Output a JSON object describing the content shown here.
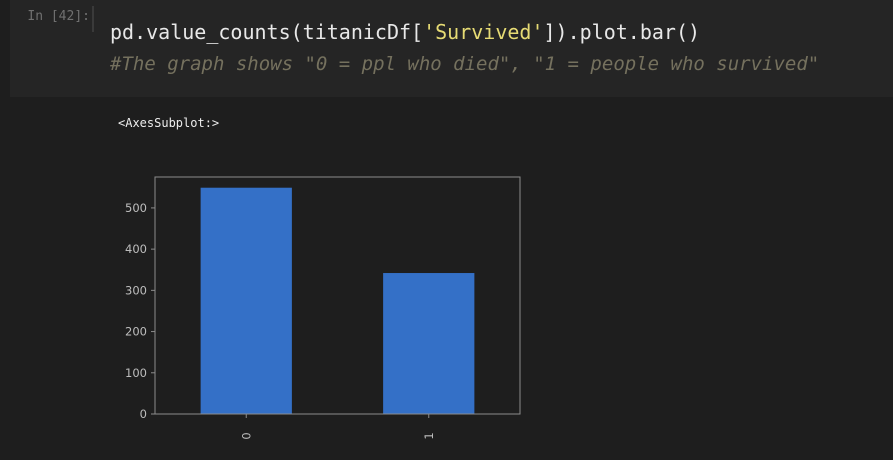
{
  "prompt": "In [42]:",
  "code": {
    "before": "pd.value_counts(titanicDf[",
    "string": "'Survived'",
    "after": "]).plot.bar()"
  },
  "comment": "#The graph shows \"0 = ppl who died\", \"1 = people who survived\"",
  "output_text": "<AxesSubplot:>",
  "colors": {
    "bar": "#3470c7",
    "axes_frame": "#8c8c8c",
    "string": "#e6db74",
    "comment": "#75715e"
  },
  "chart_data": {
    "type": "bar",
    "categories": [
      "0",
      "1"
    ],
    "values": [
      549,
      342
    ],
    "ylim": [
      0,
      575
    ],
    "yticks": [
      0,
      100,
      200,
      300,
      400,
      500
    ],
    "xlabel": "",
    "ylabel": "",
    "title": "",
    "grid": false,
    "xtick_rotation": 90
  }
}
